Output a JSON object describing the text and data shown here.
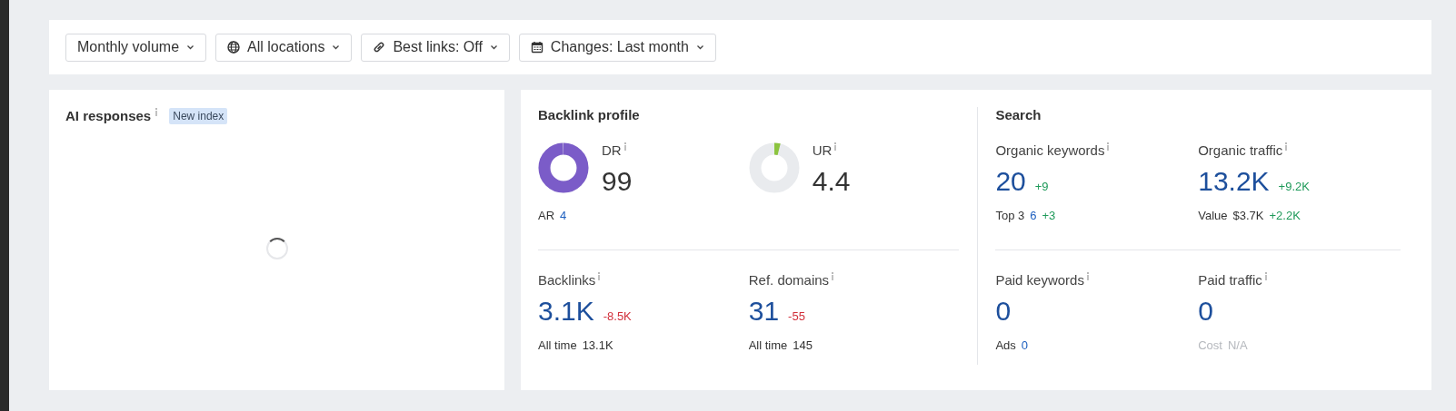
{
  "filters": [
    {
      "label": "Monthly volume",
      "kind": "plain"
    },
    {
      "label": "All locations",
      "kind": "globe"
    },
    {
      "label": "Best links: Off",
      "kind": "link"
    },
    {
      "label": "Changes: Last month",
      "kind": "calendar"
    }
  ],
  "ai_responses": {
    "title": "AI responses",
    "badge": "New index",
    "loading": true
  },
  "sections": [
    {
      "title": "Backlink profile",
      "rows": [
        [
          {
            "label": "DR",
            "value": "99",
            "kind": "ring",
            "level": 0.99,
            "color": "#7b5cc8",
            "sub": {
              "label": "AR",
              "value": "4",
              "link": true
            }
          },
          {
            "label": "UR",
            "value": "4.4",
            "kind": "ring",
            "level": 0.04,
            "color": "#8cc43f"
          }
        ],
        [
          {
            "label": "Backlinks",
            "value": "3.1K",
            "kind": "plain",
            "delta": {
              "text": "-8.5K",
              "color": "#d2303b"
            },
            "sub": {
              "label": "All time",
              "value": "13.1K",
              "link": false
            }
          },
          {
            "label": "Ref. domains",
            "value": "31",
            "kind": "plain",
            "delta": {
              "text": "-55",
              "color": "#d2303b"
            },
            "sub": {
              "label": "All time",
              "value": "145",
              "link": false
            }
          }
        ]
      ]
    },
    {
      "title": "Search",
      "rows": [
        [
          {
            "label": "Organic keywords",
            "value": "20",
            "kind": "plain",
            "delta": {
              "text": "+9",
              "color": "#1f9a5a"
            },
            "sub": {
              "label": "Top 3",
              "value": "6",
              "link": true,
              "delta": {
                "text": "+3",
                "color": "#1f9a5a"
              }
            }
          },
          {
            "label": "Organic traffic",
            "value": "13.2K",
            "kind": "plain",
            "delta": {
              "text": "+9.2K",
              "color": "#1f9a5a"
            },
            "sub": {
              "label": "Value",
              "value": "$3.7K",
              "link": false,
              "delta": {
                "text": "+2.2K",
                "color": "#1f9a5a"
              }
            }
          }
        ],
        [
          {
            "label": "Paid keywords",
            "value": "0",
            "kind": "plain",
            "sub": {
              "label": "Ads",
              "value": "0",
              "link": true
            }
          },
          {
            "label": "Paid traffic",
            "value": "0",
            "kind": "plain",
            "sub": {
              "label": "Cost",
              "value": "N/A",
              "link": false,
              "disabled": true
            }
          }
        ]
      ]
    }
  ]
}
